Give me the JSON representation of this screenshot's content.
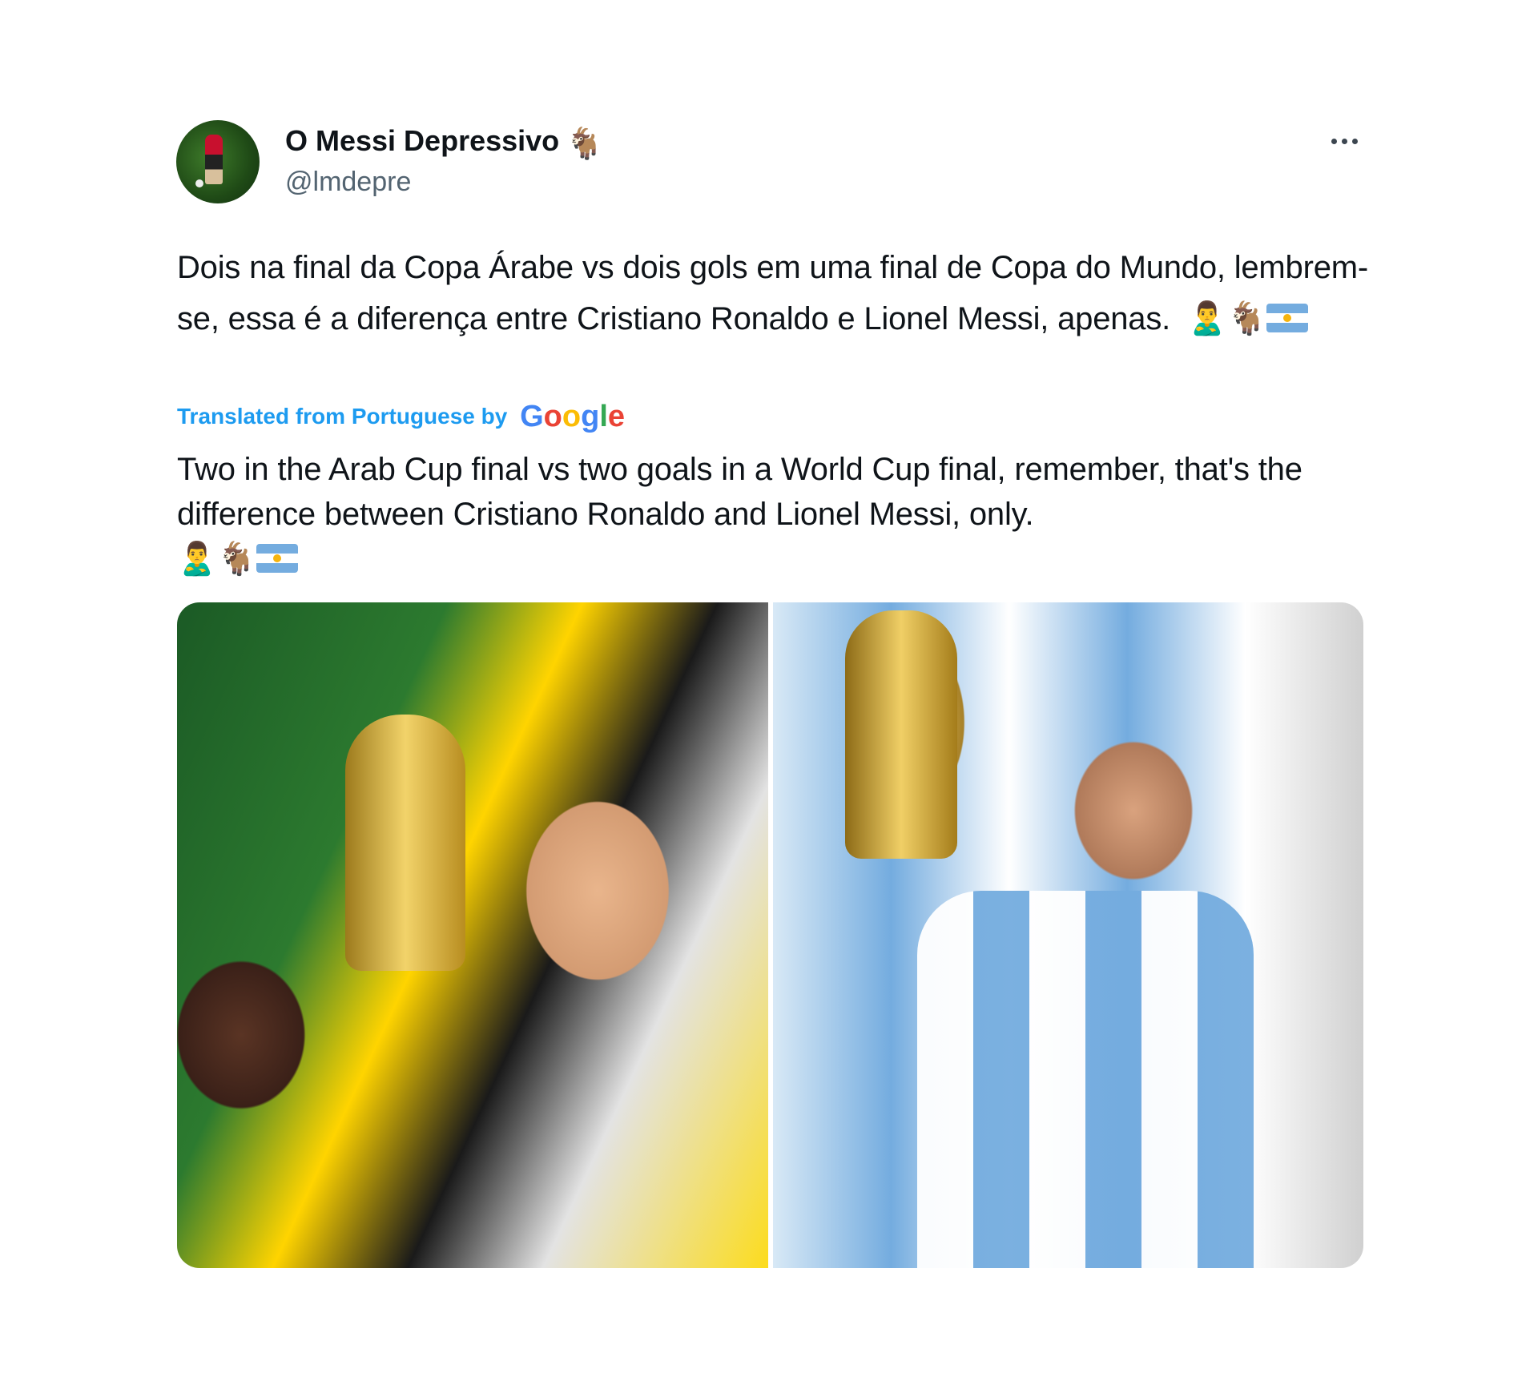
{
  "tweet": {
    "display_name": "O Messi Depressivo",
    "name_emoji": "🐐",
    "handle": "@lmdepre",
    "text_original": "Dois na final da Copa Árabe vs dois gols em uma final de Copa do Mundo, lembrem-se, essa é a diferença entre Cristiano Ronaldo e Lionel Messi, apenas.",
    "translated_from_label": "Translated from Portuguese by",
    "translation_provider": "Google",
    "text_translated": "Two in the Arab Cup final vs two goals in a World Cup final, remember, that's the difference between Cristiano Ronaldo and Lionel Messi, only.",
    "emojis": {
      "person": "🙎‍♂️",
      "goat": "🐐"
    },
    "images": [
      {
        "name": "photo-cristiano-arab-cup"
      },
      {
        "name": "photo-messi-world-cup"
      }
    ]
  }
}
